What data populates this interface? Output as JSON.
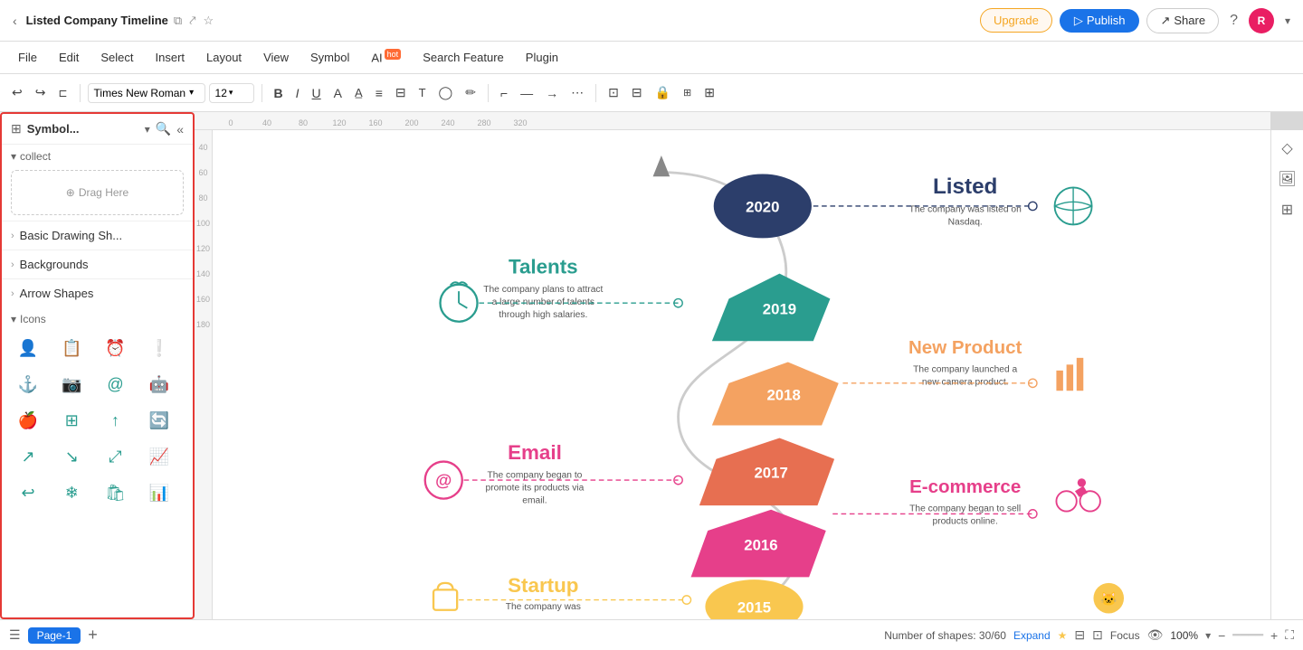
{
  "app": {
    "title": "Listed Company Timeline",
    "tab_icon": "📄",
    "window_controls": [
      "back",
      "forward"
    ]
  },
  "topbar": {
    "upgrade_label": "Upgrade",
    "publish_label": "Publish",
    "share_label": "Share",
    "help_icon": "?",
    "avatar_initial": "R"
  },
  "menubar": {
    "items": [
      "File",
      "Edit",
      "Select",
      "Insert",
      "Layout",
      "View",
      "Symbol",
      "AI",
      "Search Feature",
      "Plugin"
    ],
    "ai_badge": "hot"
  },
  "toolbar": {
    "font_name": "Times New Roman",
    "font_size": "12",
    "undo": "↩",
    "redo": "↪"
  },
  "sidebar": {
    "title": "Symbol...",
    "collect_label": "collect",
    "drag_here": "Drag Here",
    "categories": [
      {
        "name": "Basic Drawing Sh...",
        "id": "basic"
      },
      {
        "name": "Backgrounds",
        "id": "backgrounds"
      },
      {
        "name": "Arrow Shapes",
        "id": "arrows"
      }
    ],
    "icons_label": "Icons",
    "icons": [
      "👤",
      "📋",
      "⏰",
      "❗",
      "⚓",
      "📷",
      "@",
      "🤖",
      "🍎",
      "⊞",
      "↑",
      "🔄",
      "↗",
      "↘",
      "⤢",
      "📈",
      "↩",
      "❄",
      "🛍",
      "📊"
    ]
  },
  "canvas": {
    "timeline_title": "Listed",
    "timeline_subtitle": "The company was listed on Nasdaq.",
    "new_product_title": "New Product",
    "new_product_desc": "The company launched a new camera product.",
    "ecommerce_title": "E-commerce",
    "ecommerce_desc": "The company began to sell products online.",
    "talents_title": "Talents",
    "talents_desc": "The company plans to attract a large number of talents through high salaries.",
    "email_title": "Email",
    "email_desc": "The company began to promote its products via email.",
    "startup_title": "Startup",
    "startup_desc": "The company was established.",
    "years": [
      "2020",
      "2019",
      "2018",
      "2017",
      "2016",
      "2015"
    ]
  },
  "bottombar": {
    "page_label": "Page-1",
    "tab_label": "Page-1",
    "shapes_text": "Number of shapes: 30/60",
    "expand_label": "Expand",
    "focus_label": "Focus",
    "zoom_level": "100%"
  },
  "right_panel": {
    "icons": [
      "◇",
      "⊞",
      "⊟"
    ]
  }
}
